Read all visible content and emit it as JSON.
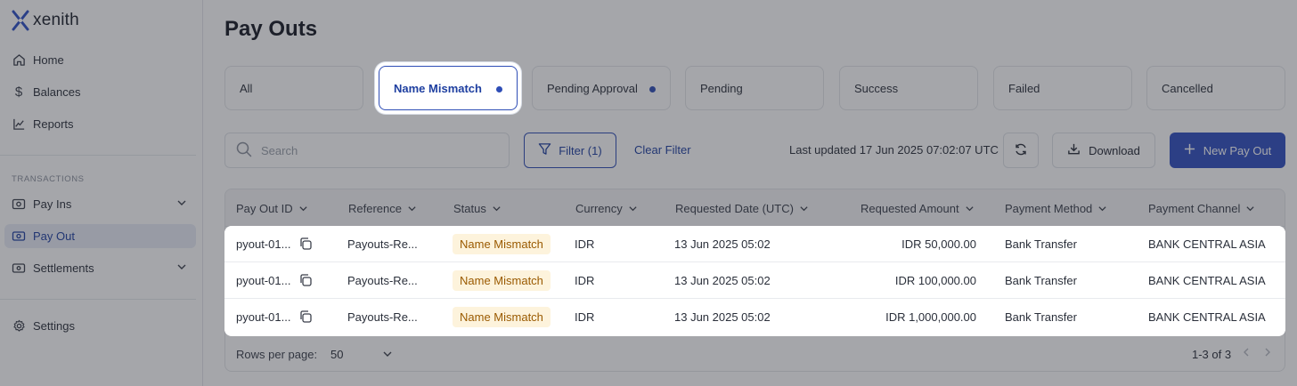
{
  "app": {
    "name": "xenith"
  },
  "sidebar": {
    "home": "Home",
    "balances": "Balances",
    "reports": "Reports",
    "section_label": "TRANSACTIONS",
    "pay_ins": "Pay Ins",
    "pay_out": "Pay Out",
    "settlements": "Settlements",
    "settings": "Settings"
  },
  "page": {
    "title": "Pay Outs"
  },
  "tabs": [
    {
      "label": "All"
    },
    {
      "label": "Name Mismatch"
    },
    {
      "label": "Pending Approval"
    },
    {
      "label": "Pending"
    },
    {
      "label": "Success"
    },
    {
      "label": "Failed"
    },
    {
      "label": "Cancelled"
    }
  ],
  "toolbar": {
    "search_placeholder": "Search",
    "filter_label": "Filter (1)",
    "clear_filter": "Clear Filter",
    "last_updated": "Last updated 17 Jun 2025 07:02:07 UTC",
    "download": "Download",
    "new_payout": "New Pay Out"
  },
  "table": {
    "columns": [
      "Pay Out ID",
      "Reference",
      "Status",
      "Currency",
      "Requested Date (UTC)",
      "Requested Amount",
      "Payment Method",
      "Payment Channel"
    ],
    "rows": [
      {
        "id": "pyout-01...",
        "reference": "Payouts-Re...",
        "status": "Name Mismatch",
        "currency": "IDR",
        "date": "13 Jun 2025 05:02",
        "amount": "IDR 50,000.00",
        "method": "Bank Transfer",
        "channel": "BANK CENTRAL ASIA"
      },
      {
        "id": "pyout-01...",
        "reference": "Payouts-Re...",
        "status": "Name Mismatch",
        "currency": "IDR",
        "date": "13 Jun 2025 05:02",
        "amount": "IDR 100,000.00",
        "method": "Bank Transfer",
        "channel": "BANK CENTRAL ASIA"
      },
      {
        "id": "pyout-01...",
        "reference": "Payouts-Re...",
        "status": "Name Mismatch",
        "currency": "IDR",
        "date": "13 Jun 2025 05:02",
        "amount": "IDR 1,000,000.00",
        "method": "Bank Transfer",
        "channel": "BANK CENTRAL ASIA"
      }
    ],
    "footer": {
      "rows_per_page_label": "Rows per page:",
      "rows_per_page_value": "50",
      "pager_info": "1-3 of 3"
    }
  },
  "colors": {
    "accent": "#2f4fc0",
    "badge_bg": "#fdf3dc",
    "badge_text": "#9a5a00"
  }
}
